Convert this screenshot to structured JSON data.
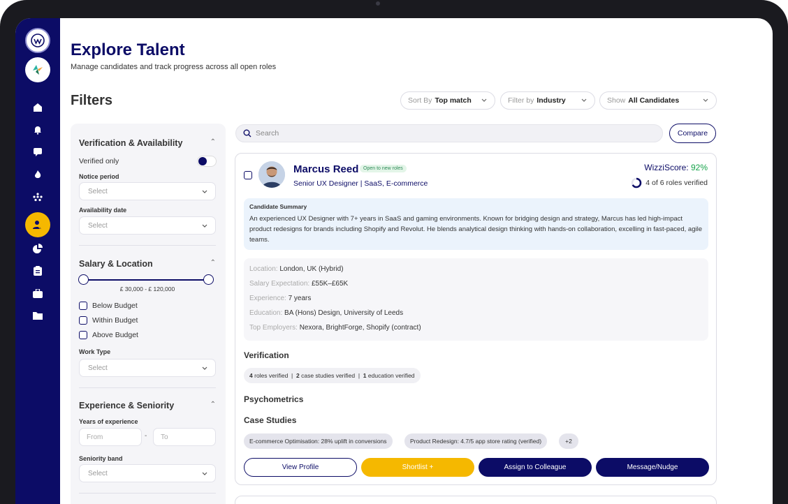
{
  "header": {
    "title": "Explore Talent",
    "subtitle": "Manage candidates and track progress across all open roles"
  },
  "filters": {
    "title": "Filters",
    "verification": {
      "title": "Verification & Availability",
      "verified_only": "Verified only",
      "verified_only_on": true,
      "notice_label": "Notice period",
      "notice_value": "Select",
      "availability_label": "Availability date",
      "availability_value": "Select"
    },
    "salary": {
      "title": "Salary & Location",
      "range": "£ 30,000 - £ 120,000",
      "below": "Below Budget",
      "within": "Within Budget",
      "above": "Above Budget",
      "work_type_label": "Work Type",
      "work_type_value": "Select"
    },
    "experience": {
      "title": "Experience & Seniority",
      "years_label": "Years of experience",
      "from_placeholder": "From",
      "dash": "-",
      "to_placeholder": "To",
      "band_label": "Seniority band",
      "band_value": "Select"
    }
  },
  "toolbar": {
    "sort_label": "Sort By",
    "sort_value": "Top match",
    "filter_label": "Filter by",
    "filter_value": "Industry",
    "show_label": "Show",
    "show_value": "All Candidates",
    "search_placeholder": "Search",
    "compare": "Compare"
  },
  "candidate": {
    "name": "Marcus Reed",
    "badge": "Open to new roles",
    "role": "Senior UX Designer",
    "sectors": "SaaS, E-commerce",
    "wizzi_label": "WizziScore:",
    "wizzi_value": "92%",
    "roles_verified": "4 of 6 roles verified",
    "roles_verified_fraction": 0.6667,
    "summary_title": "Candidate Summary",
    "summary": "An experienced UX Designer with 7+ years in SaaS and gaming environments. Known for bridging design and strategy, Marcus has led high-impact product redesigns for brands including Shopify and Revolut. He blends analytical design thinking with hands-on  collaboration, excelling in fast-paced, agile teams.",
    "details": [
      {
        "label": "Location:",
        "value": "London, UK (Hybrid)"
      },
      {
        "label": "Salary Expectation:",
        "value": "£55K–£65K"
      },
      {
        "label": "Experience:",
        "value": "7 years"
      },
      {
        "label": "Education:",
        "value": "BA (Hons) Design, University of Leeds"
      },
      {
        "label": "Top Employers:",
        "value": "Nexora, BrightForge, Shopify (contract)"
      }
    ],
    "verification_title": "Verification",
    "verification": {
      "roles_n": "4",
      "roles_t": "roles verified",
      "cases_n": "2",
      "cases_t": "case studies verified",
      "edu_n": "1",
      "edu_t": "education verified",
      "sep": "|"
    },
    "psychometrics_title": "Psychometrics",
    "case_studies_title": "Case Studies",
    "case_studies": [
      "E-commerce Optimisation: 28% uplift in conversions",
      "Product Redesign: 4.7/5 app store rating (verified)",
      "+2"
    ],
    "actions": {
      "view": "View Profile",
      "shortlist": "Shortlist +",
      "assign": "Assign to Colleague",
      "message": "Message/Nudge"
    }
  },
  "colors": {
    "navy": "#0c0c66",
    "accent": "#f5b800",
    "score_green": "#16a34a",
    "summary_bg": "#ebf3fc"
  },
  "icons": [
    "home-icon",
    "bell-icon",
    "chat-icon",
    "flame-icon",
    "network-icon",
    "talent-search-icon",
    "pie-chart-icon",
    "clipboard-icon",
    "briefcase-icon",
    "folder-icon"
  ]
}
